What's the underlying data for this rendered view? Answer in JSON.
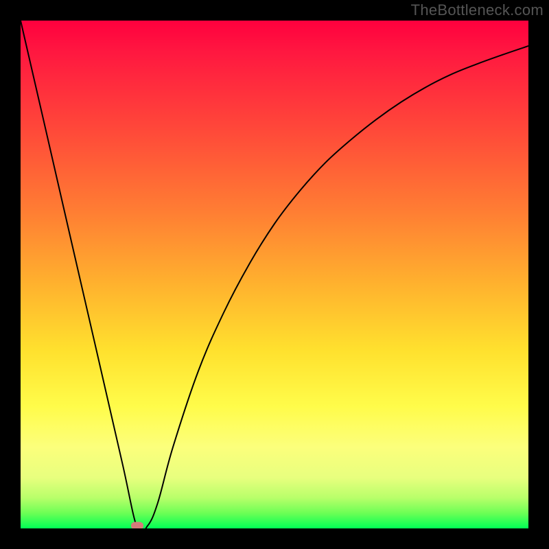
{
  "watermark": "TheBottleneck.com",
  "chart_data": {
    "type": "line",
    "title": "",
    "xlabel": "",
    "ylabel": "",
    "xlim": [
      0,
      100
    ],
    "ylim": [
      0,
      100
    ],
    "grid": false,
    "legend": false,
    "series": [
      {
        "name": "curve",
        "x": [
          0,
          5,
          10,
          15,
          20,
          23,
          25,
          27,
          30,
          35,
          40,
          45,
          50,
          55,
          60,
          65,
          70,
          75,
          80,
          85,
          90,
          95,
          100
        ],
        "y": [
          100,
          78.3,
          56.5,
          34.8,
          13.0,
          0,
          0.5,
          5.0,
          16.0,
          31.0,
          42.5,
          52.0,
          60.0,
          66.5,
          72.0,
          76.5,
          80.5,
          84.0,
          87.0,
          89.5,
          91.5,
          93.3,
          95.0
        ]
      }
    ],
    "minimum_marker": {
      "x": 23,
      "y": 0
    },
    "background_gradient": {
      "top": "#ff003e",
      "mid": "#ffe12e",
      "bottom": "#00ff55"
    }
  }
}
